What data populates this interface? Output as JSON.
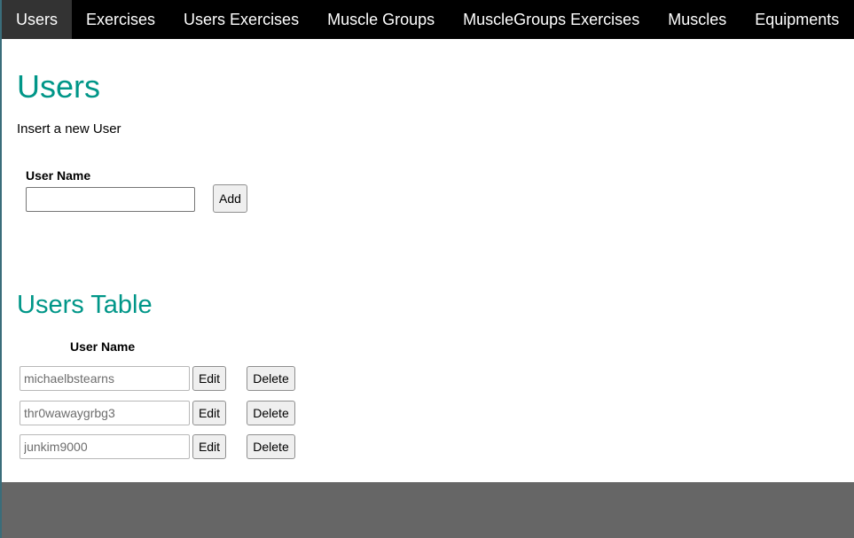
{
  "nav": {
    "items": [
      {
        "label": "Users"
      },
      {
        "label": "Exercises"
      },
      {
        "label": "Users Exercises"
      },
      {
        "label": "Muscle Groups"
      },
      {
        "label": "MuscleGroups Exercises"
      },
      {
        "label": "Muscles"
      },
      {
        "label": "Equipments"
      }
    ],
    "active_index": 0
  },
  "main": {
    "title": "Users",
    "insert_label": "Insert a new User",
    "form": {
      "field_label": "User Name",
      "input_value": "",
      "add_label": "Add"
    },
    "table_title": "Users Table",
    "table": {
      "column_header": "User Name",
      "edit_label": "Edit",
      "delete_label": "Delete",
      "rows": [
        {
          "user_name": "michaelbstearns"
        },
        {
          "user_name": "thr0wawaygrbg3"
        },
        {
          "user_name": "junkim9000"
        }
      ]
    }
  },
  "colors": {
    "accent": "#009688",
    "nav_background": "#000000",
    "nav_active": "#333333",
    "footer": "#666666"
  }
}
